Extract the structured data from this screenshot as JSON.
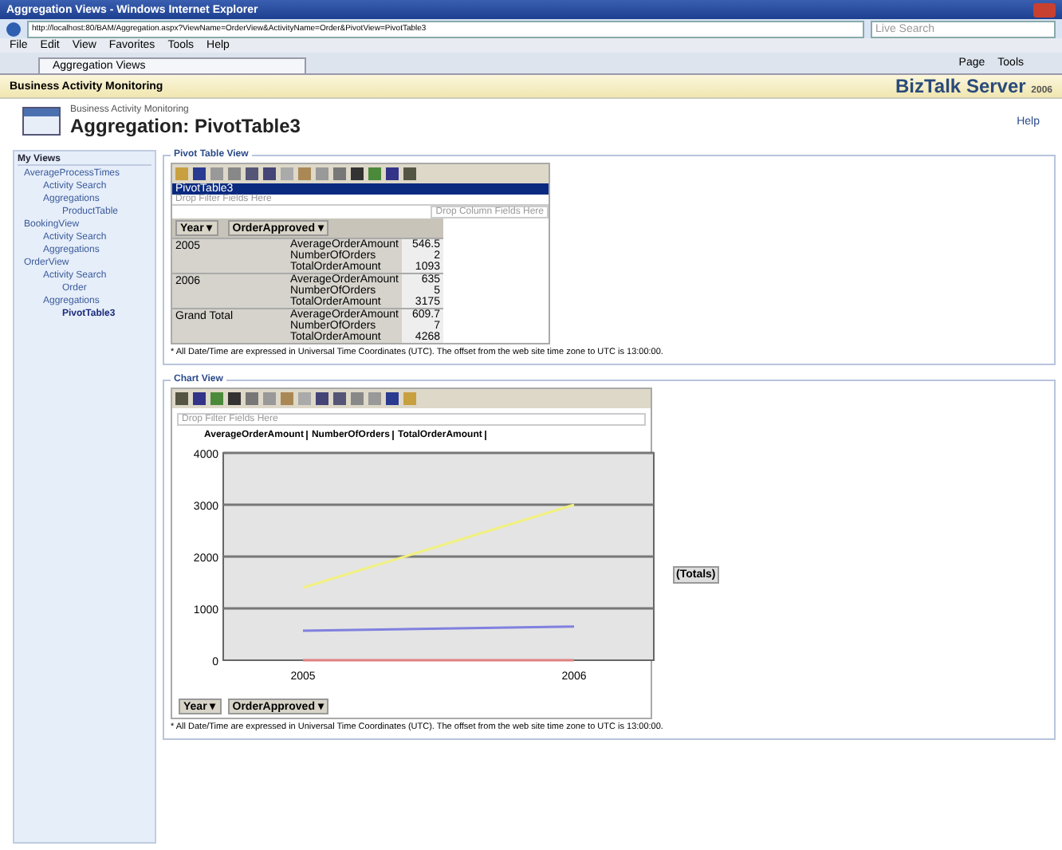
{
  "window": {
    "title": "Aggregation Views - Windows Internet Explorer"
  },
  "address_bar": {
    "url": "http://localhost:80/BAM/Aggregation.aspx?ViewName=OrderView&ActivityName=Order&PivotView=PivotTable3",
    "search_placeholder": "Live Search"
  },
  "menu": [
    "File",
    "Edit",
    "View",
    "Favorites",
    "Tools",
    "Help"
  ],
  "browser_tab": {
    "label": "Aggregation Views"
  },
  "command_bar": [
    "Page",
    "Tools"
  ],
  "header": {
    "title": "Business Activity Monitoring",
    "logo": "BizTalk Server",
    "logo_version": "2006"
  },
  "page": {
    "subtitle": "Business Activity Monitoring",
    "title": "Aggregation: PivotTable3",
    "help": "Help"
  },
  "sidebar": {
    "title": "My Views",
    "items": [
      {
        "label": "AverageProcessTimes",
        "selected": false,
        "children": [
          {
            "label": "Activity Search",
            "selected": false
          },
          {
            "label": "Aggregations",
            "selected": false,
            "children": [
              {
                "label": "ProductTable",
                "selected": false
              }
            ]
          }
        ]
      },
      {
        "label": "BookingView",
        "selected": false,
        "children": [
          {
            "label": "Activity Search",
            "selected": false
          },
          {
            "label": "Aggregations",
            "selected": false
          }
        ]
      },
      {
        "label": "OrderView",
        "selected": false,
        "children": [
          {
            "label": "Activity Search",
            "selected": false,
            "children": [
              {
                "label": "Order",
                "selected": false
              }
            ]
          },
          {
            "label": "Aggregations",
            "selected": false,
            "children": [
              {
                "label": "PivotTable3",
                "selected": true
              }
            ]
          }
        ]
      }
    ]
  },
  "pivot_panel": {
    "title": "Pivot Table View",
    "table_name": "PivotTable3",
    "filter_drop": "Drop Filter Fields Here",
    "column_drop": "Drop Column Fields Here",
    "row_fields": [
      "Year ▾",
      "OrderApproved ▾"
    ],
    "rows": [
      {
        "group": "2005",
        "measures": [
          {
            "name": "AverageOrderAmount",
            "value": "546.5"
          },
          {
            "name": "NumberOfOrders",
            "value": "2"
          },
          {
            "name": "TotalOrderAmount",
            "value": "1093"
          }
        ]
      },
      {
        "group": "2006",
        "measures": [
          {
            "name": "AverageOrderAmount",
            "value": "635"
          },
          {
            "name": "NumberOfOrders",
            "value": "5"
          },
          {
            "name": "TotalOrderAmount",
            "value": "3175"
          }
        ]
      },
      {
        "group": "Grand Total",
        "measures": [
          {
            "name": "AverageOrderAmount",
            "value": "609.7"
          },
          {
            "name": "NumberOfOrders",
            "value": "7"
          },
          {
            "name": "TotalOrderAmount",
            "value": "4268"
          }
        ]
      }
    ],
    "footnote": "* All Date/Time are expressed in Universal Time Coordinates (UTC). The offset from the web site time zone to UTC is 13:00:00."
  },
  "chart_panel": {
    "title": "Chart View",
    "filter_drop": "Drop Filter Fields Here",
    "legend": "(Totals)",
    "axis_fields": [
      "Year ▾",
      "OrderApproved ▾"
    ],
    "chart_data": {
      "type": "line",
      "grid": true,
      "categories": [
        "2005",
        "2006"
      ],
      "ylim": [
        0,
        4000
      ],
      "yticks": [
        0,
        1000,
        2000,
        3000,
        4000
      ],
      "series": [
        {
          "name": "AverageOrderAmount",
          "color": "#8080e0",
          "values": [
            570,
            650
          ]
        },
        {
          "name": "NumberOfOrders",
          "color": "#e08080",
          "values": [
            0,
            0
          ]
        },
        {
          "name": "TotalOrderAmount",
          "color": "#f0f080",
          "values": [
            1400,
            3000
          ]
        }
      ]
    },
    "footnote": "* All Date/Time are expressed in Universal Time Coordinates (UTC). The offset from the web site time zone to UTC is 13:00:00."
  }
}
